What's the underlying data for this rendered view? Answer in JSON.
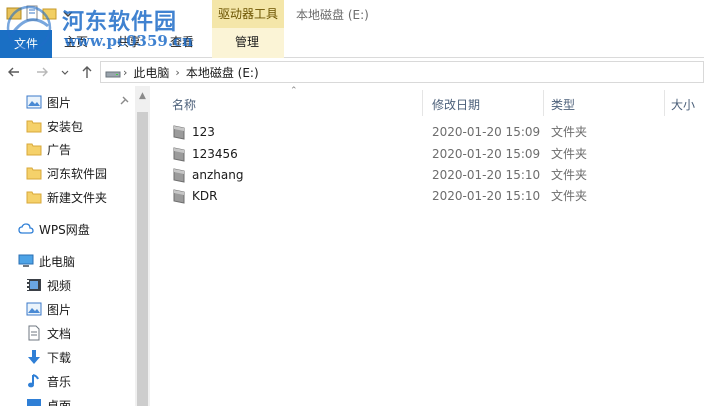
{
  "window": {
    "title": "本地磁盘 (E:)",
    "context_tab_group": "驱动器工具"
  },
  "watermark": {
    "title": "河东软件园",
    "url": "www.pc0359.cn"
  },
  "ribbon": {
    "tabs": [
      {
        "label": "文件"
      },
      {
        "label": "主页"
      },
      {
        "label": "共享"
      },
      {
        "label": "查看"
      },
      {
        "label": "管理"
      }
    ]
  },
  "address": {
    "breadcrumbs": [
      "此电脑",
      "本地磁盘 (E:)"
    ]
  },
  "navpane": {
    "quick_access": [
      {
        "label": "图片",
        "icon": "pictures-icon",
        "pinned": true
      },
      {
        "label": "安装包",
        "icon": "folder-icon"
      },
      {
        "label": "广告",
        "icon": "folder-icon"
      },
      {
        "label": "河东软件园",
        "icon": "folder-icon"
      },
      {
        "label": "新建文件夹",
        "icon": "folder-icon"
      }
    ],
    "wps": {
      "label": "WPS网盘",
      "icon": "cloud-icon"
    },
    "this_pc": {
      "label": "此电脑",
      "icon": "computer-icon"
    },
    "pc_items": [
      {
        "label": "视频",
        "icon": "video-icon"
      },
      {
        "label": "图片",
        "icon": "pictures-icon"
      },
      {
        "label": "文档",
        "icon": "document-icon"
      },
      {
        "label": "下载",
        "icon": "download-icon"
      },
      {
        "label": "音乐",
        "icon": "music-icon"
      },
      {
        "label": "桌面",
        "icon": "desktop-icon"
      }
    ]
  },
  "table": {
    "headers": {
      "name": "名称",
      "date": "修改日期",
      "type": "类型",
      "size": "大小"
    },
    "rows": [
      {
        "name": "123",
        "date": "2020-01-20 15:09",
        "type": "文件夹"
      },
      {
        "name": "123456",
        "date": "2020-01-20 15:09",
        "type": "文件夹"
      },
      {
        "name": "anzhang",
        "date": "2020-01-20 15:10",
        "type": "文件夹"
      },
      {
        "name": "KDR",
        "date": "2020-01-20 15:10",
        "type": "文件夹"
      }
    ]
  },
  "colors": {
    "accent": "#1a6fc4",
    "context_tab": "#f4e6a9",
    "header_text": "#4c607a",
    "watermark": "#1f6dc8"
  }
}
